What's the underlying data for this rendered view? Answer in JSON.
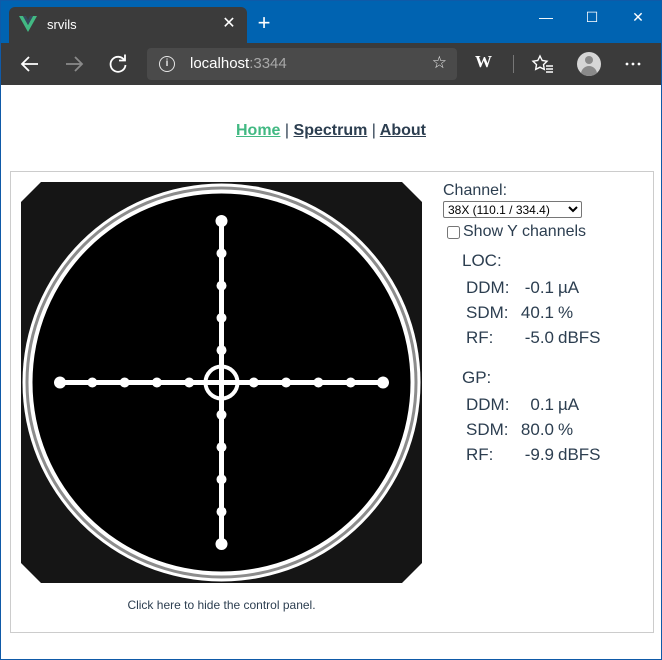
{
  "browser": {
    "tab_title": "srvils",
    "address_host": "localhost",
    "address_port": ":3344",
    "window_controls": {
      "minimize": "—",
      "maximize": "☐",
      "close": "✕"
    },
    "toolbar_icons": [
      "back-icon",
      "forward-icon",
      "refresh-icon",
      "info-icon",
      "star-icon",
      "wikipedia-extension-icon",
      "favorites-icon",
      "profile-icon",
      "more-icon"
    ],
    "accent_color": "#0063b1",
    "toolbar_color": "#3b3b3b"
  },
  "nav": {
    "home": "Home",
    "spectrum": "Spectrum",
    "about": "About",
    "separator": "|",
    "active_color": "#42b983"
  },
  "channel": {
    "label": "Channel:",
    "selected": "38X (110.1 / 334.4)",
    "show_y_label": "Show Y channels",
    "show_y_checked": false
  },
  "loc": {
    "title": "LOC:",
    "ddm_label": "DDM:",
    "ddm_value": "-0.1",
    "ddm_unit": "µA",
    "sdm_label": "SDM:",
    "sdm_value": "40.1",
    "sdm_unit": "%",
    "rf_label": "RF:",
    "rf_value": "-5.0",
    "rf_unit": "dBFS"
  },
  "gp": {
    "title": "GP:",
    "ddm_label": "DDM:",
    "ddm_value": "0.1",
    "ddm_unit": "µA",
    "sdm_label": "SDM:",
    "sdm_value": "80.0",
    "sdm_unit": "%",
    "rf_label": "RF:",
    "rf_value": "-9.9",
    "rf_unit": "dBFS"
  },
  "indicator": {
    "loc_deflection": -0.1,
    "gp_deflection": 0.1
  },
  "hide_link": "Click here to hide the control panel."
}
